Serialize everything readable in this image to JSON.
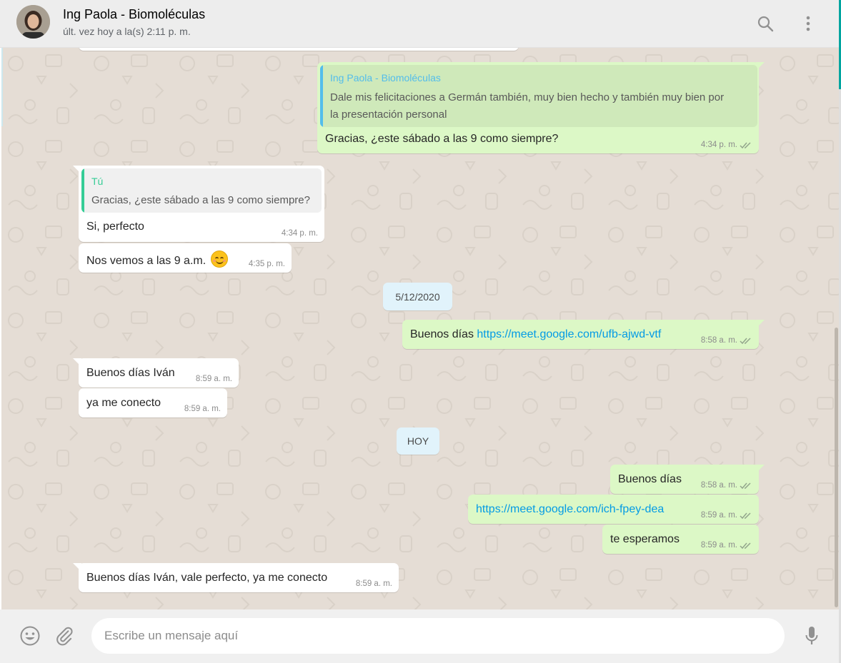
{
  "header": {
    "contact_name": "Ing Paola - Biomoléculas",
    "last_seen": "últ. vez hoy a la(s) 2:11 p. m.",
    "search_icon": "search-icon",
    "menu_icon": "more-vertical-icon"
  },
  "messages": {
    "m1": {
      "quote_name": "Ing Paola - Biomoléculas",
      "quote_line1": "Dale mis felicitaciones a Germán también, muy bien hecho y también muy bien por",
      "quote_line2": "la presentación personal",
      "text": "Gracias, ¿este sábado a las 9 como siempre?",
      "time": "4:34 p. m."
    },
    "m2": {
      "quote_name": "Tú",
      "quote_text": "Gracias, ¿este sábado a las 9 como siempre?",
      "text": "Si, perfecto",
      "time": "4:34 p. m."
    },
    "m3": {
      "text": "Nos vemos a las 9 a.m.",
      "emoji": "smiling-face-icon",
      "time": "4:35 p. m."
    },
    "date1": "5/12/2020",
    "m4": {
      "prefix": "Buenos días ",
      "link": "https://meet.google.com/ufb-ajwd-vtf",
      "time": "8:58 a. m."
    },
    "m5": {
      "text": "Buenos días Iván",
      "time": "8:59 a. m."
    },
    "m6": {
      "text": "ya me conecto",
      "time": "8:59 a. m."
    },
    "date2": "HOY",
    "m7": {
      "text": "Buenos días",
      "time": "8:58 a. m."
    },
    "m8": {
      "link": "https://meet.google.com/ich-fpey-dea",
      "time": "8:59 a. m."
    },
    "m9": {
      "text": "te esperamos",
      "time": "8:59 a. m."
    },
    "m10": {
      "text": "Buenos días Iván, vale perfecto, ya me conecto",
      "time": "8:59 a. m."
    }
  },
  "footer": {
    "placeholder": "Escribe un mensaje aquí",
    "emoji_icon": "emoji-icon",
    "attach_icon": "attach-icon",
    "mic_icon": "microphone-icon"
  },
  "colors": {
    "incoming": "#ffffff",
    "outgoing": "#dcf8c6",
    "chat_bg": "#e5ddd5",
    "link": "#039be5",
    "quote_self": "#35cd96",
    "quote_other": "#53bdeb"
  }
}
